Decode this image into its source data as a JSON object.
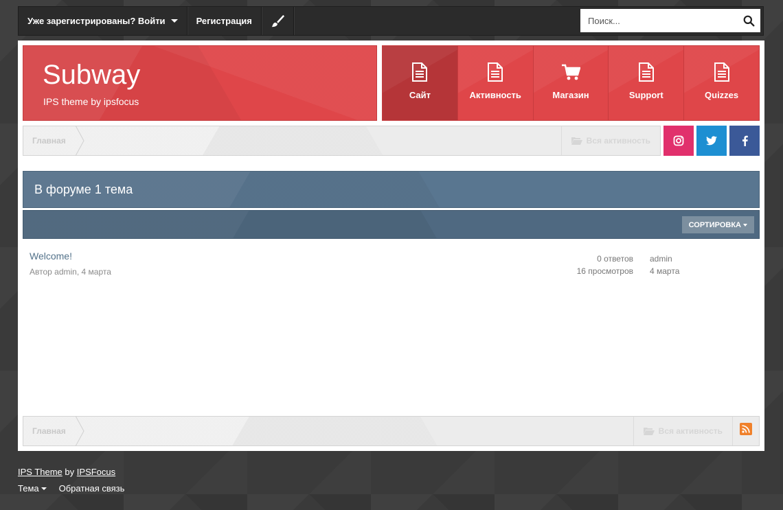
{
  "userbar": {
    "signin_label": "Уже зарегистрированы? Войти",
    "register_label": "Регистрация",
    "search_placeholder": "Поиск..."
  },
  "brand": {
    "title": "Subway",
    "subtitle": "IPS theme by ipsfocus",
    "color": "#df4649"
  },
  "nav": {
    "tabs": [
      {
        "label": "Сайт",
        "icon": "document-icon",
        "active": true
      },
      {
        "label": "Активность",
        "icon": "document-icon",
        "active": false
      },
      {
        "label": "Магазин",
        "icon": "cart-icon",
        "active": false
      },
      {
        "label": "Support",
        "icon": "document-icon",
        "active": false
      },
      {
        "label": "Quizzes",
        "icon": "document-icon",
        "active": false
      }
    ]
  },
  "breadcrumb": {
    "home": "Главная",
    "all_activity": "Вся активность"
  },
  "social": {
    "instagram_color": "#e1306c",
    "twitter_color": "#1d8fd2",
    "facebook_color": "#3b5998"
  },
  "forum": {
    "heading": "В форуме 1 тема",
    "sort_label": "СОРТИРОВКА"
  },
  "topics": [
    {
      "title": "Welcome!",
      "author_prefix": "Автор",
      "author": "admin",
      "date": "4 марта",
      "replies": "0 ответов",
      "views": "16 просмотров",
      "last_user": "admin",
      "last_date": "4 марта"
    }
  ],
  "footer": {
    "credit_theme": "IPS Theme",
    "credit_by": "by",
    "credit_author": "IPSFocus",
    "theme_label": "Тема",
    "feedback_label": "Обратная связь"
  }
}
